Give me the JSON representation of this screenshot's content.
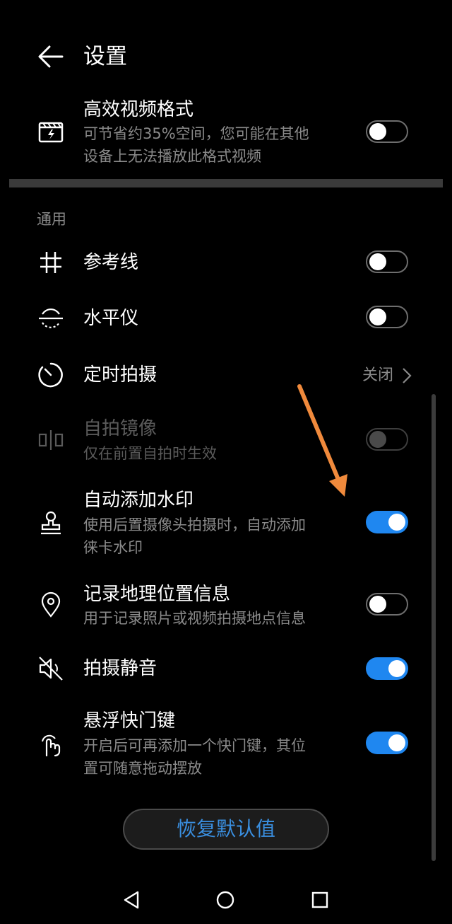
{
  "header": {
    "title": "设置",
    "back_icon": "arrow-left-icon"
  },
  "top_item": {
    "title": "高效视频格式",
    "subtitle_line1": "可节省约35%空间，您可能在其他",
    "subtitle_line2": "设备上无法播放此格式视频",
    "icon": "video-format-icon",
    "toggle": "off"
  },
  "section_general": "通用",
  "items": {
    "grid": {
      "title": "参考线",
      "icon": "grid-icon",
      "toggle": "off"
    },
    "level": {
      "title": "水平仪",
      "icon": "level-icon",
      "toggle": "off"
    },
    "timer": {
      "title": "定时拍摄",
      "icon": "timer-icon",
      "value": "关闭"
    },
    "mirror": {
      "title": "自拍镜像",
      "subtitle": "仅在前置自拍时生效",
      "icon": "mirror-icon",
      "toggle": "off-disabled"
    },
    "watermark": {
      "title": "自动添加水印",
      "subtitle_line1": "使用后置摄像头拍摄时，自动添加",
      "subtitle_line2": "徕卡水印",
      "icon": "stamp-icon",
      "toggle": "on"
    },
    "location": {
      "title": "记录地理位置信息",
      "subtitle": "用于记录照片或视频拍摄地点信息",
      "icon": "location-pin-icon",
      "toggle": "off"
    },
    "mute": {
      "title": "拍摄静音",
      "icon": "mute-icon",
      "toggle": "on"
    },
    "floating": {
      "title": "悬浮快门键",
      "subtitle_line1": "开启后可再添加一个快门键，其位",
      "subtitle_line2": "置可随意拖动摆放",
      "icon": "floating-shutter-icon",
      "toggle": "on"
    }
  },
  "restore_button": "恢复默认值",
  "colors": {
    "accent": "#1f87f0",
    "annotation_arrow": "#f08a3c",
    "background": "#000000"
  },
  "navbar": {
    "back": "nav-back-icon",
    "home": "nav-home-icon",
    "recents": "nav-recents-icon"
  }
}
